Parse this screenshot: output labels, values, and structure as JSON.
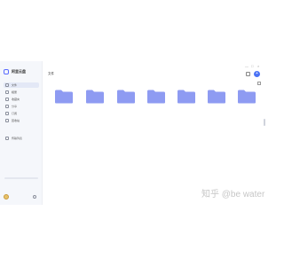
{
  "app": {
    "name": "阿里云盘",
    "accent_color": "#5b6cff",
    "logo_icon": "cloud-drive-logo-icon"
  },
  "sidebar": {
    "items": [
      {
        "label": "文件",
        "icon": "file-icon",
        "active": true
      },
      {
        "label": "相册",
        "icon": "photo-icon",
        "active": false
      },
      {
        "label": "收藏夹",
        "icon": "star-icon",
        "active": false
      },
      {
        "label": "分享",
        "icon": "share-icon",
        "active": false
      },
      {
        "label": "订阅",
        "icon": "subscribe-icon",
        "active": false
      },
      {
        "label": "回收站",
        "icon": "trash-icon",
        "active": false
      },
      {
        "label": "传输列表",
        "icon": "transfer-icon",
        "active": false
      }
    ],
    "quota": {
      "text": "",
      "link": "",
      "used_fraction": 0.0
    },
    "user": {
      "name": ""
    }
  },
  "header": {
    "title": "文件",
    "window_controls": [
      "—",
      "□",
      "×"
    ],
    "upload_symbol": "+"
  },
  "list": {
    "column_head": "",
    "sort_label": ""
  },
  "folders": [
    {
      "name": "",
      "date": ""
    },
    {
      "name": "",
      "date": ""
    },
    {
      "name": "",
      "date": ""
    },
    {
      "name": "",
      "date": ""
    },
    {
      "name": "",
      "date": ""
    },
    {
      "name": "",
      "date": ""
    },
    {
      "name": "",
      "date": ""
    }
  ],
  "watermark": "知乎 @be water",
  "folder_color": "#8e9bf2"
}
